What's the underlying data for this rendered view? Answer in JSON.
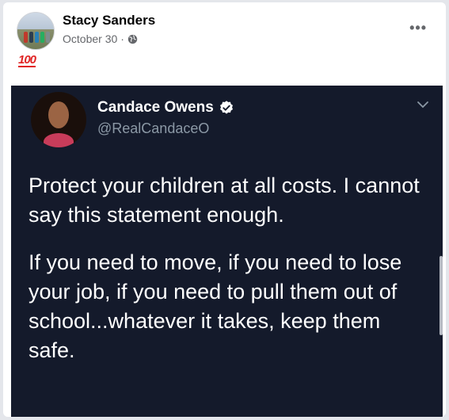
{
  "post": {
    "author_name": "Stacy Sanders",
    "date": "October 30",
    "date_separator": "·",
    "more_label": "•••",
    "emoji_label": "100"
  },
  "tweet": {
    "name": "Candace Owens",
    "handle": "@RealCandaceO",
    "paragraph1": "Protect your children at all costs. I cannot say this statement enough.",
    "paragraph2": "If you need to move, if you need to lose your job, if you need to pull them out of school...whatever it takes, keep them safe."
  },
  "icons": {
    "privacy": "globe-icon",
    "verified": "verified-badge-icon",
    "menu": "chevron-down-icon",
    "more": "more-options-icon"
  },
  "colors": {
    "tweet_bg": "#141a2b",
    "verified_badge": "#ffffff",
    "emoji_red": "#e02424"
  }
}
